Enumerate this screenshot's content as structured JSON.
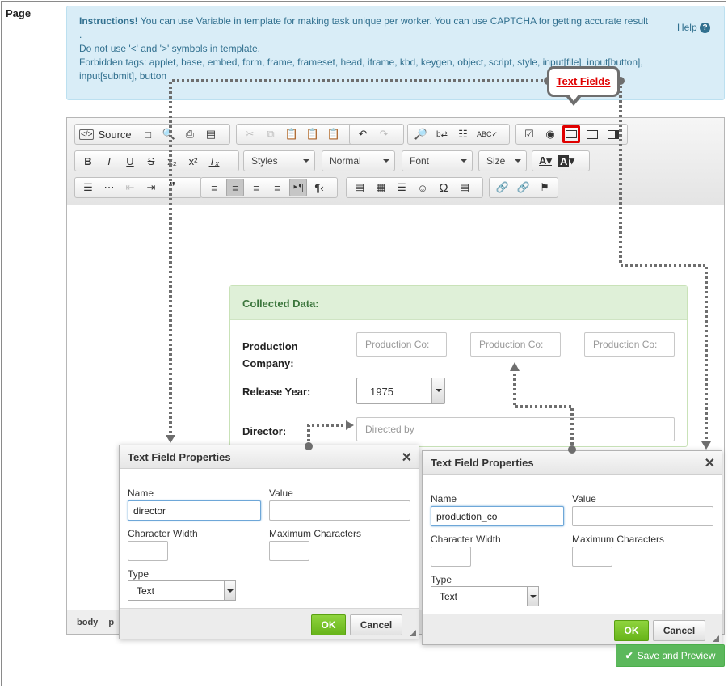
{
  "page": {
    "label": "Page"
  },
  "instructions": {
    "heading": "Instructions!",
    "line1": " You can use Variable in template for making task unique per worker. You can use CAPTCHA for getting accurate result",
    "help_label": "Help",
    "line2": ".",
    "line3": "Do not use '<' and '>' symbols in template.",
    "line4": "Forbidden tags: applet, base, embed, form, frame, frameset, head, iframe, kbd, keygen, object, script, style, input[file], input[button],",
    "line5": "input[submit], button"
  },
  "callout": {
    "label": "Text Fields"
  },
  "toolbar": {
    "source_label": "Source",
    "styles_label": "Styles",
    "format_label": "Normal",
    "font_label": "Font",
    "size_label": "Size"
  },
  "statusbar": {
    "items": [
      "body",
      "p"
    ]
  },
  "collected": {
    "header": "Collected Data:",
    "production_label": "Production Company:",
    "production_placeholder": "Production Co:",
    "release_label": "Release Year:",
    "release_value": "1975",
    "director_label": "Director:",
    "director_placeholder": "Directed by"
  },
  "dialog1": {
    "title": "Text Field Properties",
    "name_label": "Name",
    "name_value": "director",
    "value_label": "Value",
    "value_value": "",
    "width_label": "Character Width",
    "max_label": "Maximum Characters",
    "type_label": "Type",
    "type_value": "Text",
    "ok_label": "OK",
    "cancel_label": "Cancel"
  },
  "dialog2": {
    "title": "Text Field Properties",
    "name_label": "Name",
    "name_value": "production_co",
    "value_label": "Value",
    "value_value": "",
    "width_label": "Character Width",
    "max_label": "Maximum Characters",
    "type_label": "Type",
    "type_value": "Text",
    "ok_label": "OK",
    "cancel_label": "Cancel"
  },
  "save_button": {
    "label": "Save and Preview"
  },
  "colors": {
    "info_bg": "#d9edf7",
    "info_text": "#31708f",
    "panel_header_bg": "#dff0d8",
    "panel_header_text": "#3c763d",
    "ok_green": "#67b41a",
    "save_green": "#5cb85c",
    "highlight_red": "#e00000",
    "arrow_gray": "#6e6e6e"
  }
}
